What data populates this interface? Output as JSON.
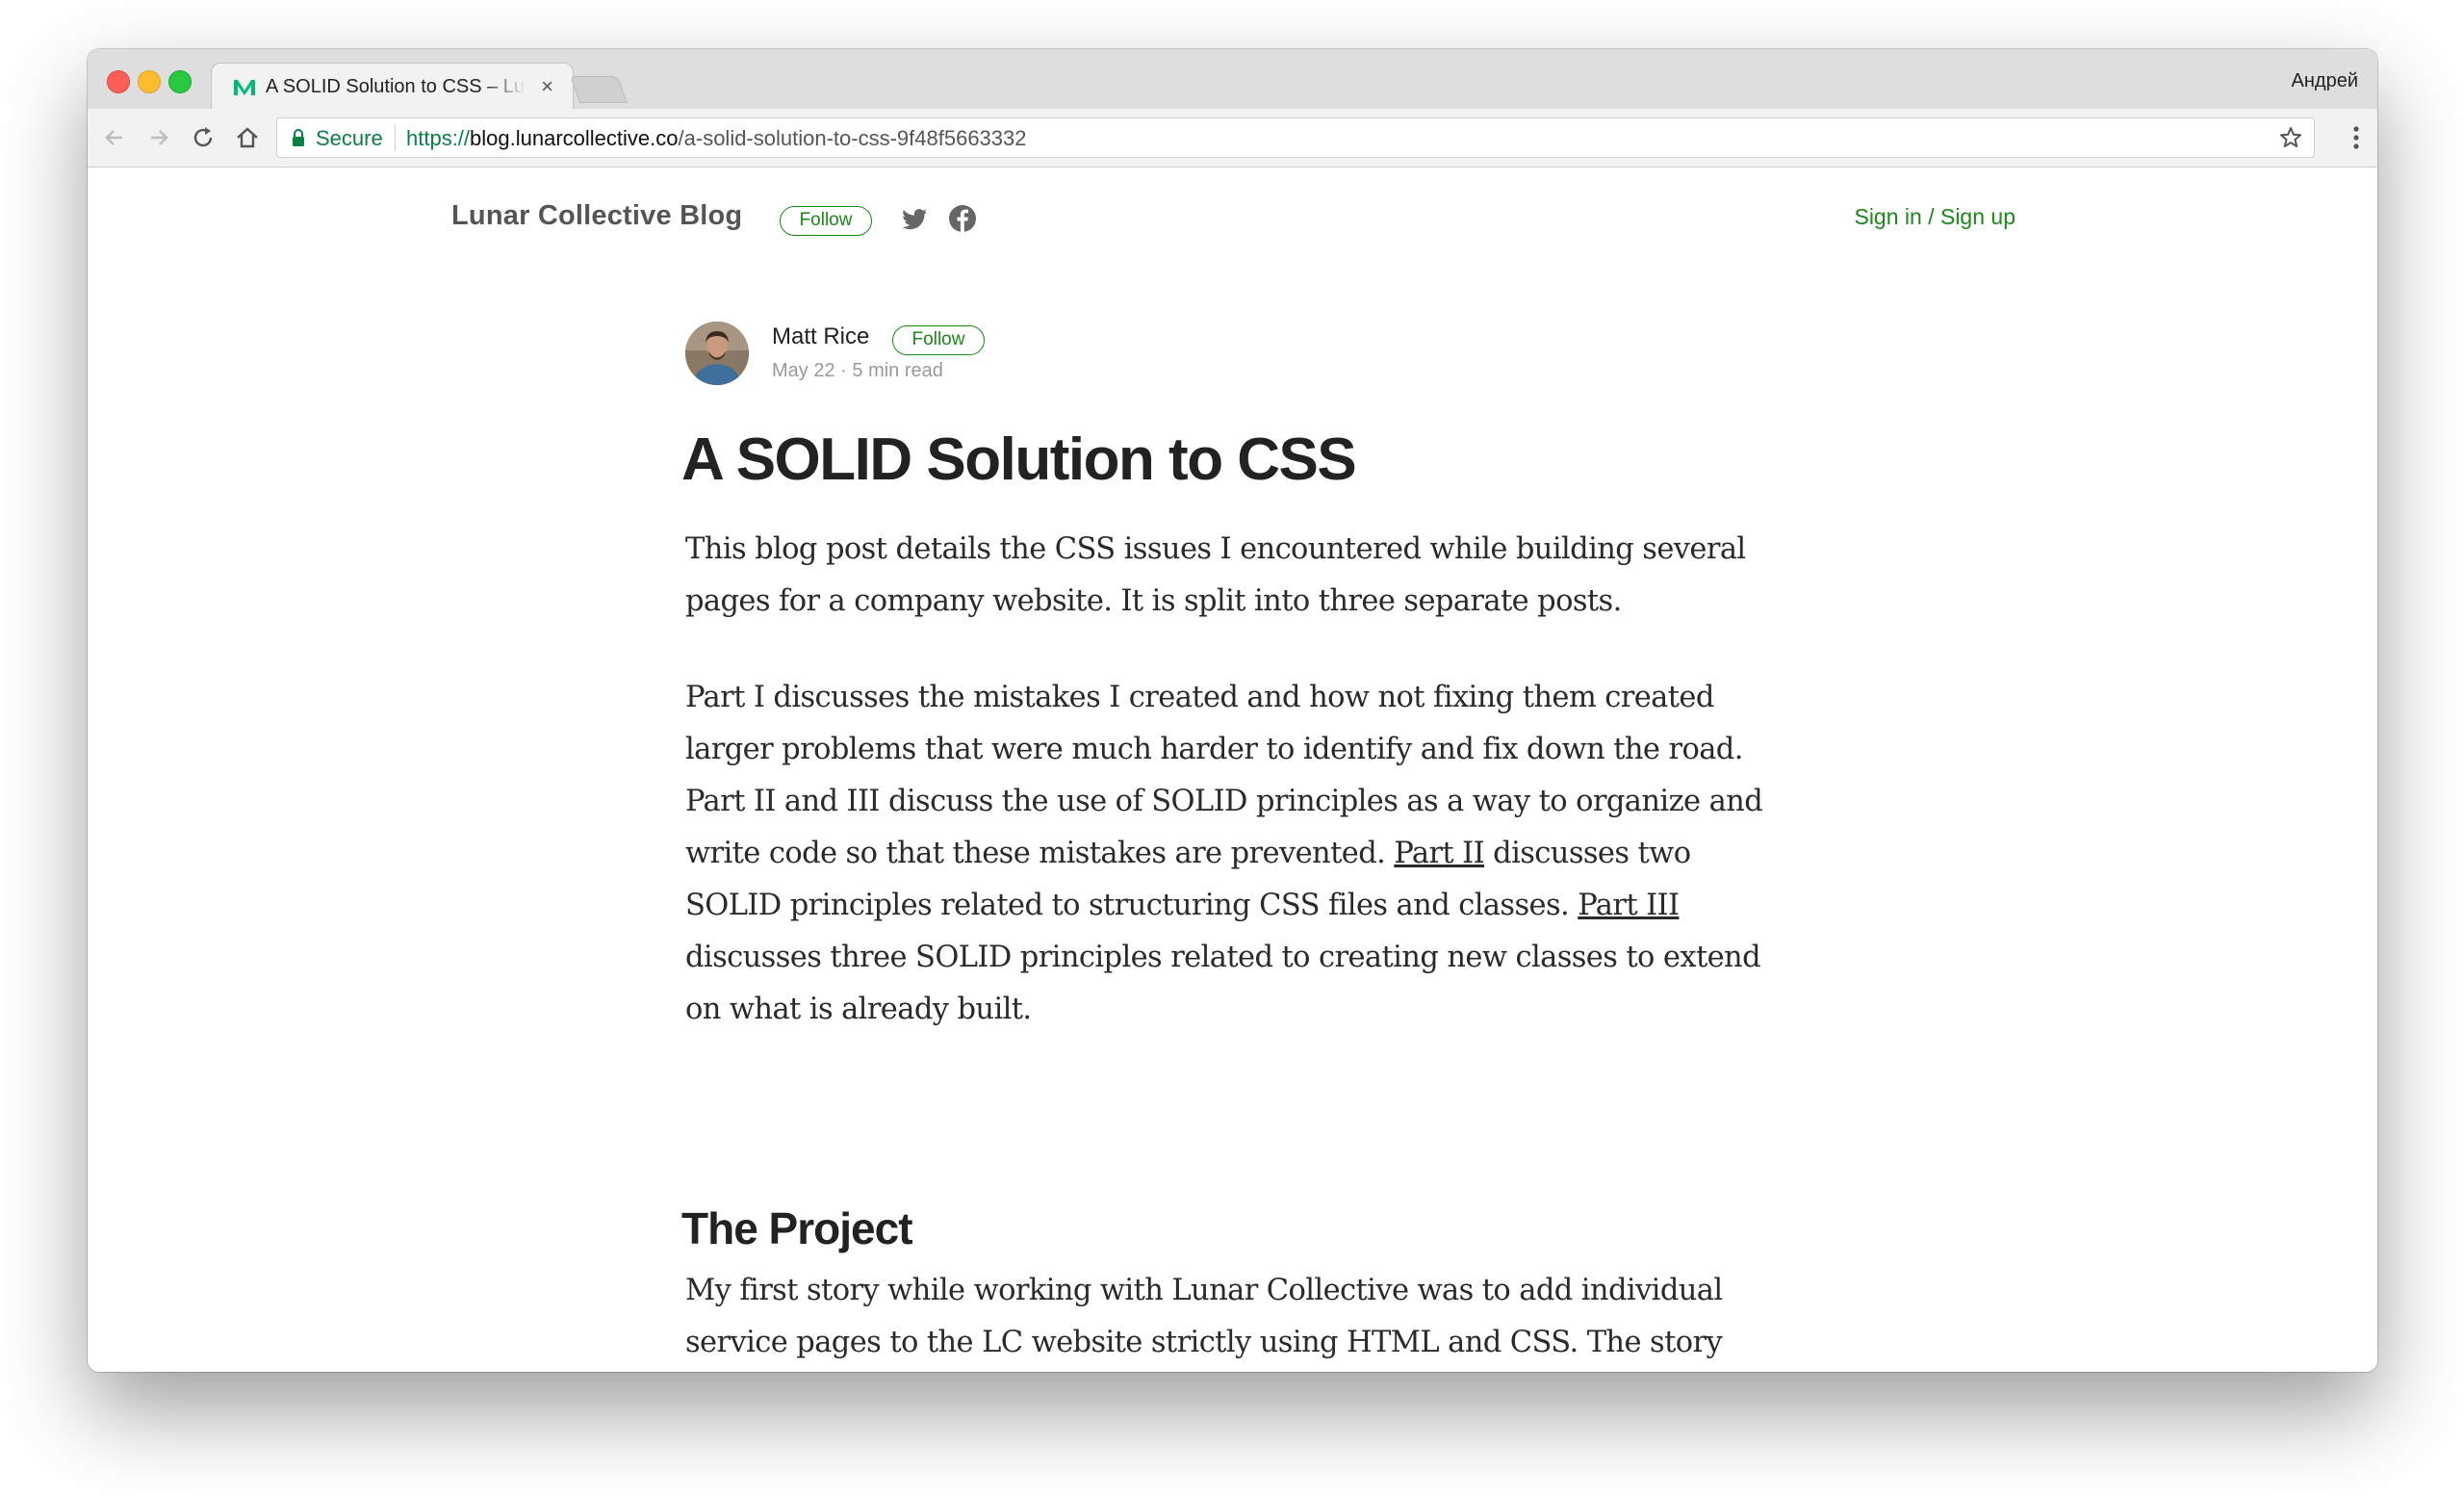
{
  "browser": {
    "tab_title": "A SOLID Solution to CSS – Lunar Collective Blog",
    "tab_close": "×",
    "profile_name": "Андрей",
    "secure_label": "Secure",
    "url_scheme": "https://",
    "url_host": "blog.lunarcollective.co",
    "url_path": "/a-solid-solution-to-css-9f48f5663332",
    "icons": [
      "back-icon",
      "forward-icon",
      "reload-icon",
      "home-icon",
      "lock-icon",
      "star-icon",
      "menu-icon"
    ]
  },
  "blog_header": {
    "name": "Lunar Collective Blog",
    "follow_label": "Follow",
    "social_icons": [
      "twitter-icon",
      "facebook-icon"
    ],
    "signin_label": "Sign in / Sign up"
  },
  "author": {
    "name": "Matt Rice",
    "follow_label": "Follow",
    "date": "May 22",
    "separator": "·",
    "read_time": "5 min read"
  },
  "article": {
    "title": "A SOLID Solution to CSS",
    "paragraph1": "This blog post details the CSS issues I encountered while building several pages for a company website. It is split into three separate posts.",
    "paragraph2_part1": "Part I discusses the mistakes I created and how not fixing them created larger problems that were much harder to identify and fix down the road. Part II and III discuss the use of SOLID principles as a way to organize and write code so that these mistakes are prevented. ",
    "link_part2": "Part II",
    "paragraph2_part2": " discusses two SOLID principles related to structuring CSS files and classes. ",
    "link_part3": "Part III",
    "paragraph2_part3": " discusses three SOLID principles related to creating new classes to extend on what is already built.",
    "section_heading": "The Project",
    "paragraph3": "My first story while working with Lunar Collective was to add individual service pages to the LC website strictly using HTML and CSS. The story involved creating a template for the service pages to keep a consistent"
  },
  "colors": {
    "accent_green": "#1a8917",
    "secure_green": "#0b8043",
    "text": "#2a2a2a"
  }
}
